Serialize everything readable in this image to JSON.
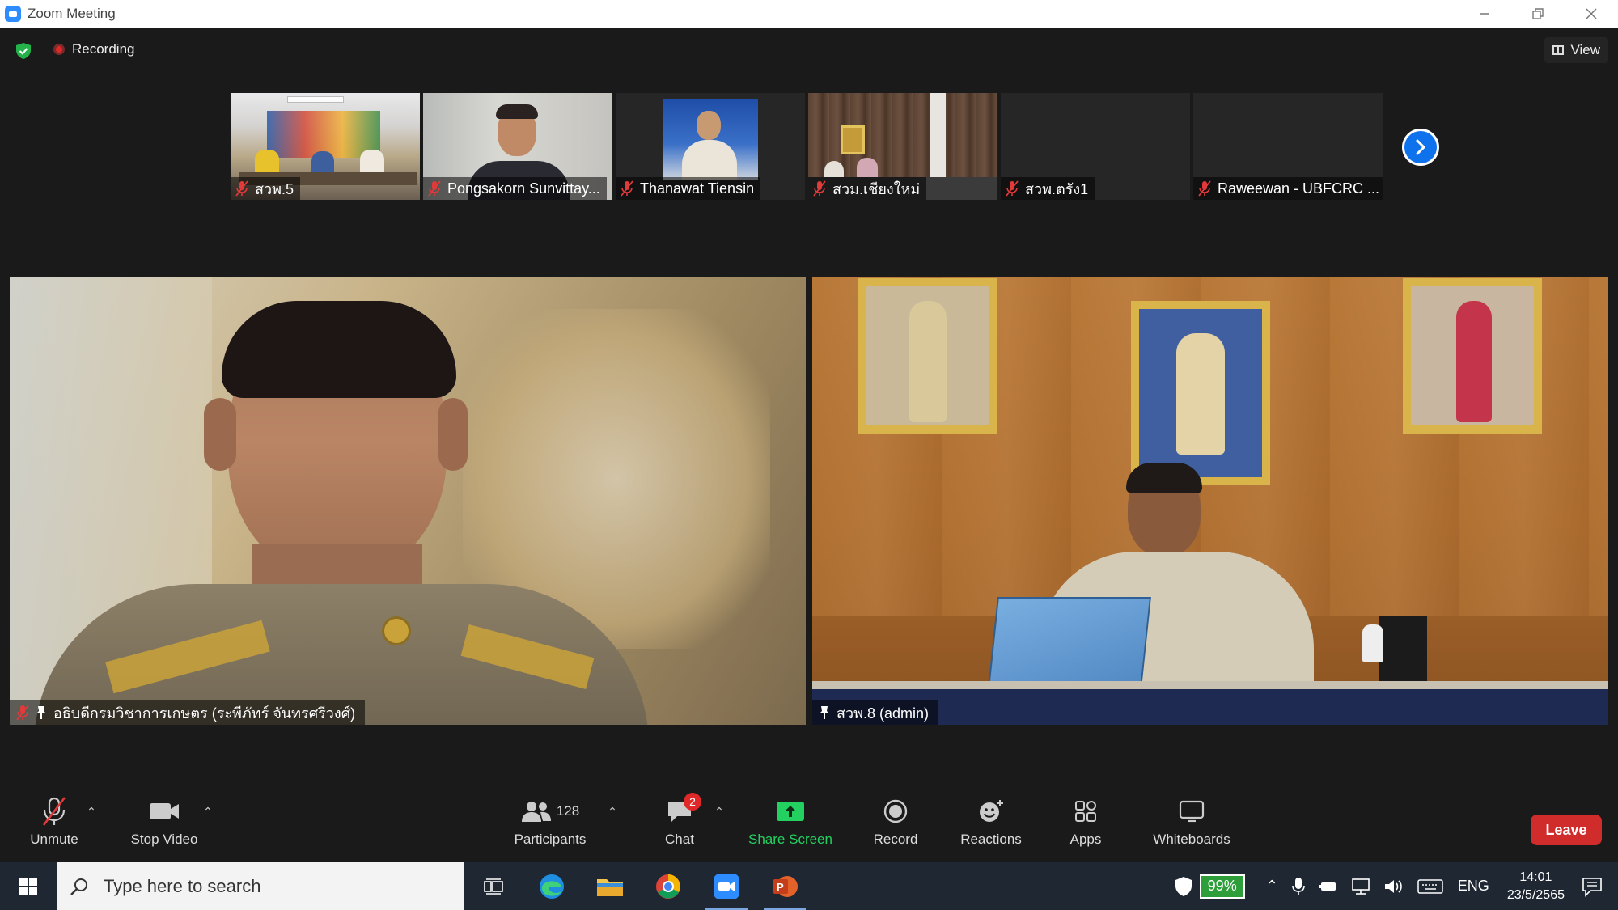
{
  "window": {
    "title": "Zoom Meeting"
  },
  "top": {
    "recording_label": "Recording",
    "view_label": "View"
  },
  "thumbnails": [
    {
      "name": "สวพ.5"
    },
    {
      "name": "Pongsakorn Sunvittay..."
    },
    {
      "name": "Thanawat Tiensin"
    },
    {
      "name": "สวม.เชียงใหม่"
    },
    {
      "name": "สวพ.ตรัง1"
    },
    {
      "name": "Raweewan - UBFCRC ..."
    }
  ],
  "videos": {
    "left": {
      "name": "อธิบดีกรมวิชาการเกษตร (ระพีภัทร์ จันทรศรีวงศ์)"
    },
    "right": {
      "name": "สวพ.8 (admin)"
    }
  },
  "toolbar": {
    "unmute": "Unmute",
    "stop_video": "Stop Video",
    "participants": "Participants",
    "participants_count": "128",
    "chat": "Chat",
    "chat_badge": "2",
    "share_screen": "Share Screen",
    "record": "Record",
    "reactions": "Reactions",
    "apps": "Apps",
    "whiteboards": "Whiteboards",
    "leave": "Leave"
  },
  "taskbar": {
    "search_placeholder": "Type here to search",
    "battery": "99%",
    "language": "ENG",
    "time": "14:01",
    "date": "23/5/2565"
  },
  "colors": {
    "accent": "#0e72ed",
    "share_green": "#23d160",
    "leave_red": "#d12c2c",
    "taskbar": "#1f2733"
  }
}
